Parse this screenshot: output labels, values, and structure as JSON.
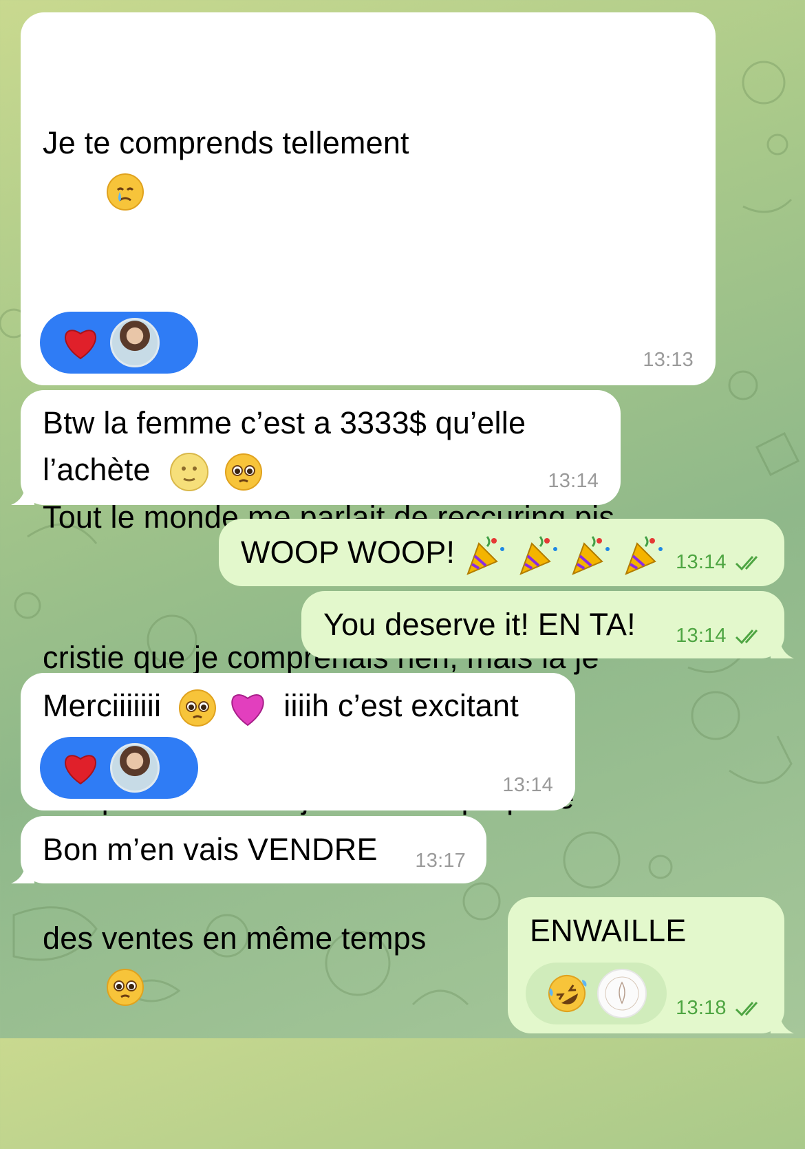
{
  "messages": [
    {
      "id": "m1",
      "direction": "incoming",
      "lines": [
        "Je te comprends tellement",
        "",
        "Tout le monde me parlait de reccuring pis",
        "cristie que je comprenais rien, mais là je",
        "comprends!!!!! Pis je PEUX superposé",
        "des ventes en même temps"
      ],
      "time": "13:13",
      "reaction": {
        "emoji": "heart",
        "avatar": "user-avatar"
      }
    },
    {
      "id": "m2",
      "direction": "incoming",
      "lines": [
        "Btw la femme c’est a 3333$ qu’elle",
        "l’achète"
      ],
      "time": "13:14"
    },
    {
      "id": "m3",
      "direction": "outgoing",
      "text": "WOOP WOOP!",
      "time": "13:14",
      "status": "read"
    },
    {
      "id": "m4",
      "direction": "outgoing",
      "text": "You deserve it! EN TA!",
      "time": "13:14",
      "status": "read"
    },
    {
      "id": "m5",
      "direction": "incoming",
      "text_before": "Merciiiiiii",
      "text_after": "iiiih c’est excitant",
      "time": "13:14",
      "reaction": {
        "emoji": "heart",
        "avatar": "user-avatar"
      }
    },
    {
      "id": "m6",
      "direction": "incoming",
      "text": "Bon m’en vais VENDRE",
      "time": "13:17"
    },
    {
      "id": "m7",
      "direction": "outgoing",
      "text": "ENWAILLE",
      "time": "13:18",
      "status": "read",
      "reaction": {
        "emoji": "rolling-on-floor-laughing",
        "avatar": "brand-logo-avatar"
      }
    }
  ],
  "colors": {
    "incoming_bubble": "#ffffff",
    "outgoing_bubble": "#e3f8cc",
    "outgoing_time": "#4ea542",
    "reaction_blue": "#2f7cf5",
    "reaction_green": "#d0ecbb"
  }
}
